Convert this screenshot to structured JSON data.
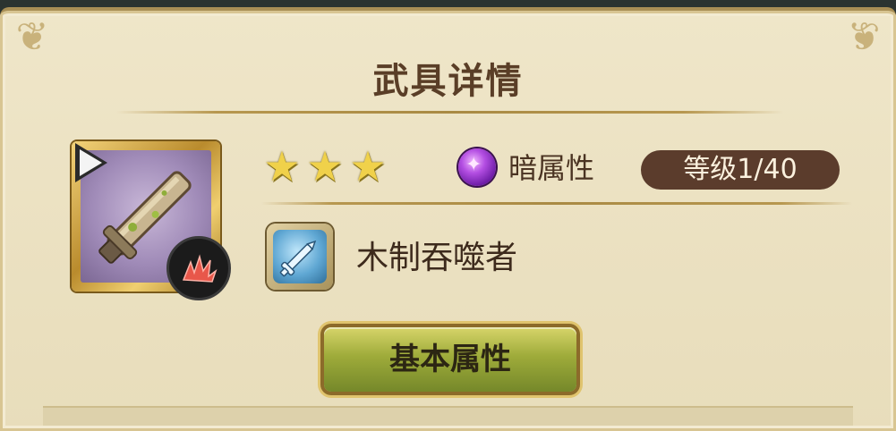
{
  "header": {
    "title": "武具详情"
  },
  "weapon": {
    "icon": "wooden-sword-icon",
    "rarity_stars": 3,
    "star_glyph": "★",
    "attribute": {
      "label": "暗属性",
      "icon": "dark-orb-icon",
      "glyph": "✦",
      "color": "#a03fd6"
    },
    "level": "等级1/40",
    "type_icon": "sword-type-icon",
    "name": "木制吞噬者",
    "skill_icon": "burst-skill-icon"
  },
  "actions": {
    "basic_stats_label": "基本属性"
  },
  "colors": {
    "panel_bg": "#ece2c3",
    "title_text": "#5a3e27",
    "level_pill_bg": "#5b3c2c",
    "button_green": "#9eab3a"
  }
}
